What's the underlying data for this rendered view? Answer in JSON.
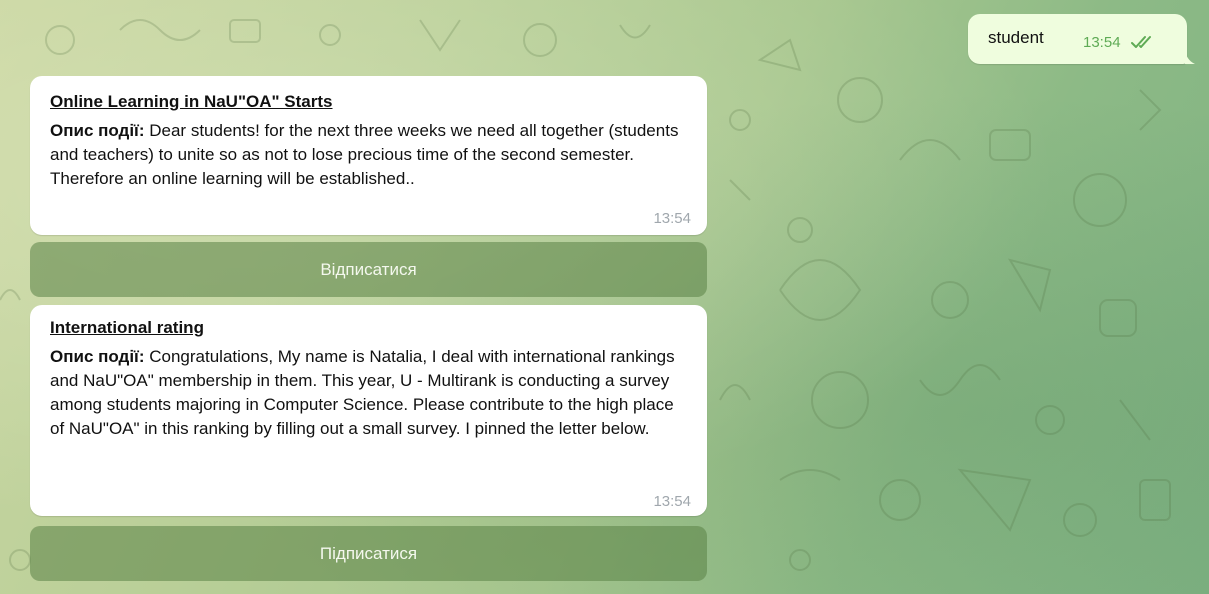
{
  "outgoing": {
    "text": "student",
    "time": "13:54",
    "status_icon": "double-check-icon"
  },
  "messages": [
    {
      "title": "Online Learning in NaU\"OA\" Starts",
      "label": "Опис події:",
      "text": "Dear students! for the next three weeks we need all together (students and teachers) to unite so as not to lose precious time of the second semester. Therefore an online learning will be established..",
      "time": "13:54",
      "button": "Відписатися"
    },
    {
      "title": "International rating",
      "label": "Опис події:",
      "text": "Congratulations, My name is Natalia, I deal with international rankings and NaU\"OA\" membership in them. This year, U - Multirank is conducting a survey among students majoring in Computer Science. Please contribute to the high place of NaU\"OA\" in this ranking by filling out a small survey. I pinned the letter below.",
      "time": "13:54",
      "button": "Підписатися"
    }
  ],
  "colors": {
    "outgoing_bubble": "#effdde",
    "incoming_bubble": "#ffffff",
    "check": "#5fab55",
    "inline_button": "#5a8246"
  }
}
